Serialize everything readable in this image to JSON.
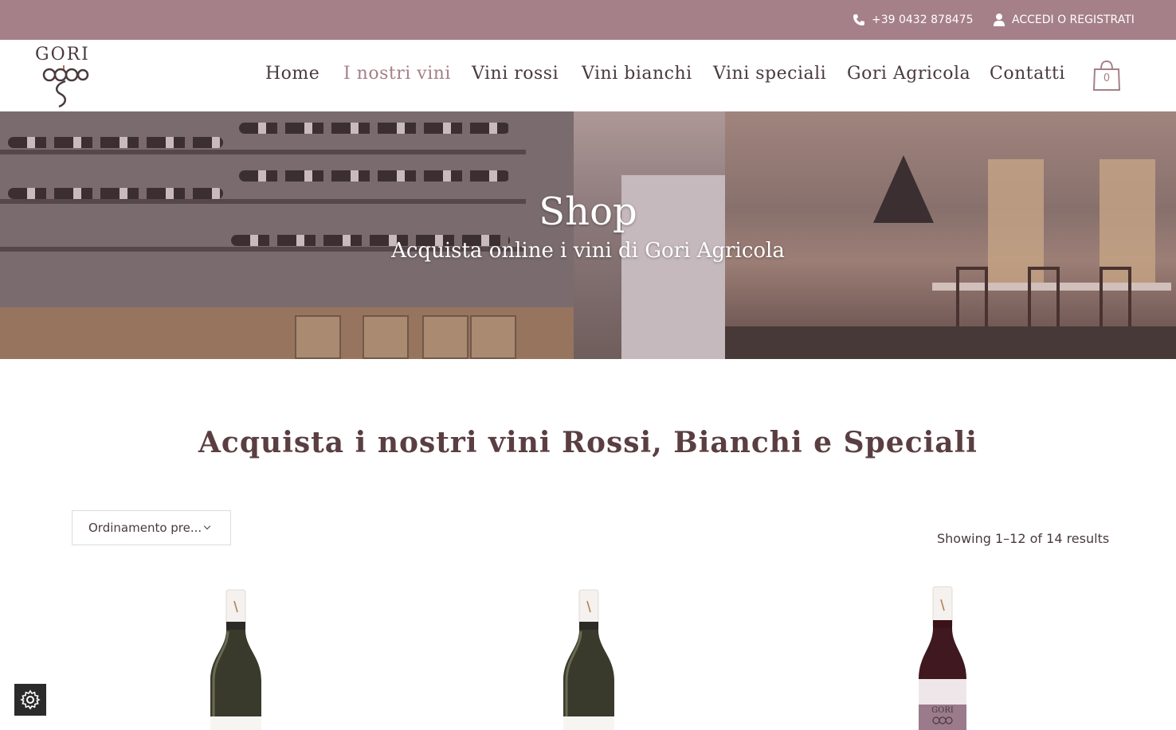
{
  "topbar": {
    "phone_icon": "phone-icon",
    "phone": "+39 0432 878475",
    "account_icon": "user-icon",
    "account": "ACCEDI O REGISTRATI"
  },
  "header": {
    "logo_text": "GORI",
    "nav": [
      {
        "label": "Home",
        "active": false
      },
      {
        "label": "I nostri vini",
        "active": true
      },
      {
        "label": "Vini rossi",
        "active": false
      },
      {
        "label": "Vini bianchi",
        "active": false
      },
      {
        "label": "Vini speciali",
        "active": false
      },
      {
        "label": "Gori Agricola",
        "active": false
      },
      {
        "label": "Contatti",
        "active": false
      }
    ],
    "cart_icon": "shopping-bag-icon",
    "cart_count": "0"
  },
  "hero": {
    "title": "Shop",
    "subtitle": "Acquista online i vini di Gori Agricola"
  },
  "main": {
    "section_title": "Acquista i nostri vini Rossi, Bianchi e Speciali",
    "orderby_value": "Ordinamento pre...",
    "results_text": "Showing 1–12 of 14 results",
    "products": [
      {
        "type": "white-wine-bottle"
      },
      {
        "type": "white-wine-bottle"
      },
      {
        "type": "red-wine-bottle",
        "label_text": "GORI"
      }
    ]
  },
  "settings_icon": "gear-icon",
  "colors": {
    "accent": "#a58088",
    "text": "#4a3a3d",
    "title": "#5a3e42"
  }
}
